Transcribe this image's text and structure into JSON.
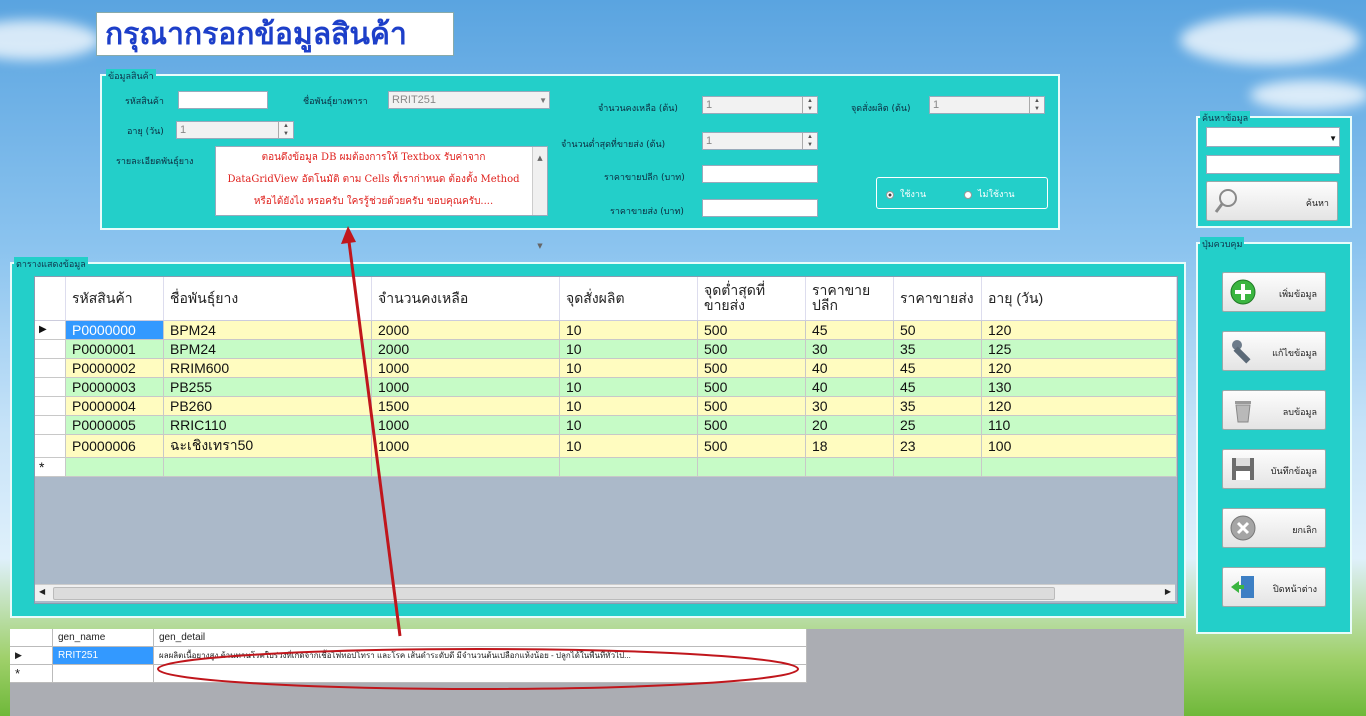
{
  "title": "กรุณากรอกข้อมูลสินค้า",
  "product_group": {
    "legend": "ข้อมูลสินค้า",
    "code_label": "รหัสสินค้า",
    "code_value": "",
    "breed_label": "ชื่อพันธุ์ยางพารา",
    "breed_value": "RRIT251",
    "age_label": "อายุ (วัน)",
    "age_value": "1",
    "detail_label": "รายละเอียดพันธุ์ยาง",
    "detail_lines": [
      "ตอนดึงข้อมูล DB ผมต้องการให้ Textbox รับค่าจาก",
      "DataGridView อัตโนมัติ ตาม Cells ที่เราก่าหนด ต้องตั้ง Method",
      "หรือได้ยังไง หรอครับ ใครรู้ช่วยด้วยครับ ขอบคุณครับ...."
    ],
    "stock_label": "จำนวนคงเหลือ (ต้น)",
    "stock_value": "1",
    "reorder_label": "จุดสั่งผลิต (ต้น)",
    "reorder_value": "1",
    "min_wholesale_label": "จำนวนต่ำสุดที่ขายส่ง (ต้น)",
    "min_wholesale_value": "1",
    "retail_label": "ราคาขายปลีก (บาท)",
    "retail_value": "",
    "wholesale_label": "ราคาขายส่ง (บาท)",
    "wholesale_value": "",
    "radio_active": "ใช้งาน",
    "radio_inactive": "ไม่ใช้งาน"
  },
  "search_group": {
    "legend": "ค้นหาข้อมูล",
    "combo_value": "",
    "text_value": "",
    "button": "ค้นหา"
  },
  "control_group": {
    "legend": "ปุ่มควบคุม",
    "buttons": [
      "เพิ่มข้อมูล",
      "แก้ไขข้อมูล",
      "ลบข้อมูล",
      "บันทึกข้อมูล",
      "ยกเลิก",
      "ปิดหน้าต่าง"
    ]
  },
  "grid_group": {
    "legend": "ตารางแสดงข้อมูล"
  },
  "products_table": {
    "columns": [
      "รหัสสินค้า",
      "ชื่อพันธุ์ยาง",
      "จำนวนคงเหลือ",
      "จุดสั่งผลิต",
      "จุดต่ำสุดที่ขายส่ง",
      "ราคาขายปลีก",
      "ราคาขายส่ง",
      "อายุ (วัน)"
    ],
    "rows": [
      [
        "P0000000",
        "BPM24",
        "2000",
        "10",
        "500",
        "45",
        "50",
        "120"
      ],
      [
        "P0000001",
        "BPM24",
        "2000",
        "10",
        "500",
        "30",
        "35",
        "125"
      ],
      [
        "P0000002",
        "RRIM600",
        "1000",
        "10",
        "500",
        "40",
        "45",
        "120"
      ],
      [
        "P0000003",
        "PB255",
        "1000",
        "10",
        "500",
        "40",
        "45",
        "130"
      ],
      [
        "P0000004",
        "PB260",
        "1500",
        "10",
        "500",
        "30",
        "35",
        "120"
      ],
      [
        "P0000005",
        "RRIC110",
        "1000",
        "10",
        "500",
        "20",
        "25",
        "110"
      ],
      [
        "P0000006",
        "ฉะเชิงเทรา50",
        "1000",
        "10",
        "500",
        "18",
        "23",
        "100"
      ]
    ]
  },
  "gen_table": {
    "columns": [
      "gen_name",
      "gen_detail"
    ],
    "rows": [
      [
        "RRIT251",
        "ผลผลิตเนื้อยางสูง ต้านทานโรคใบร่วงที่เกิดจากเชื้อไฟทอปโทรา และโรค เส้นดำระดับดี มีจำนวนต้นเปลือกแห้งน้อย - ปลูกได้ในพื้นที่ทั่วไป..."
      ]
    ]
  },
  "colors": {
    "panel": "#23cfc9",
    "title_text": "#1d3fc9",
    "annotation": "#c0161c",
    "row_yellow": "#fffcc0",
    "row_green": "#c6fbc6",
    "selection": "#3399ff"
  }
}
